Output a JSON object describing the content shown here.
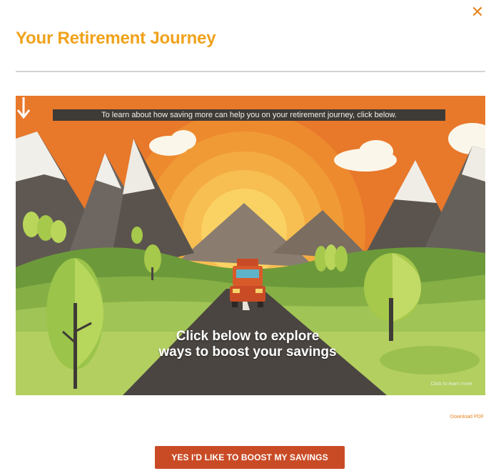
{
  "modal": {
    "title": "Your Retirement Journey",
    "close_label": "✕",
    "accent_color": "#f0a21b"
  },
  "scene": {
    "banner_text": "To learn about how saving more can help you on your retirement journey, click below.",
    "caption_line1": "Click below to explore",
    "caption_line2": "ways to boost your savings",
    "arrow_icon": "down-arrow-icon",
    "credit": "Click to learn more"
  },
  "footer": {
    "small_link": "Download PDF",
    "cta_label": "YES I'D LIKE TO BOOST MY SAVINGS",
    "cta_color": "#c94b26"
  }
}
